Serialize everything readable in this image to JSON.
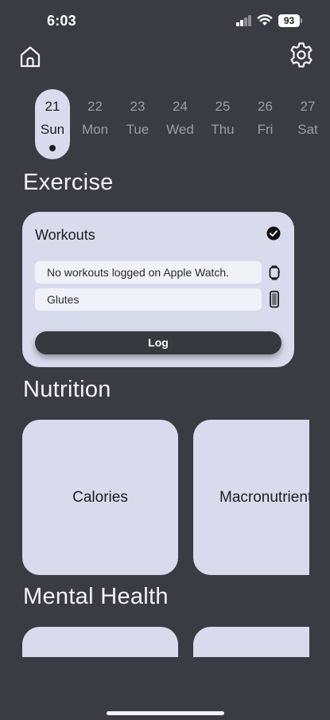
{
  "status_bar": {
    "time": "6:03",
    "battery": "93"
  },
  "nav": {
    "home_icon": "home-icon",
    "settings_icon": "gear-icon"
  },
  "days": [
    {
      "num": "21",
      "dow": "Sun",
      "selected": true,
      "has_dot": true
    },
    {
      "num": "22",
      "dow": "Mon"
    },
    {
      "num": "23",
      "dow": "Tue"
    },
    {
      "num": "24",
      "dow": "Wed"
    },
    {
      "num": "25",
      "dow": "Thu"
    },
    {
      "num": "26",
      "dow": "Fri"
    },
    {
      "num": "27",
      "dow": "Sat"
    }
  ],
  "exercise": {
    "title": "Exercise",
    "card": {
      "title": "Workouts",
      "completed_icon": "checkmark-circle-icon",
      "rows": [
        {
          "text": "No workouts logged on Apple Watch.",
          "icon": "apple-watch-icon"
        },
        {
          "text": "Glutes",
          "icon": "iphone-icon"
        }
      ],
      "log_label": "Log"
    }
  },
  "nutrition": {
    "title": "Nutrition",
    "tiles": [
      {
        "label": "Calories"
      },
      {
        "label": "Macronutrients"
      }
    ]
  },
  "mental_health": {
    "title": "Mental Health"
  },
  "colors": {
    "background": "#3b3b44",
    "card": "#d9dbec",
    "field": "#f0f1f9",
    "button": "#38383f"
  }
}
